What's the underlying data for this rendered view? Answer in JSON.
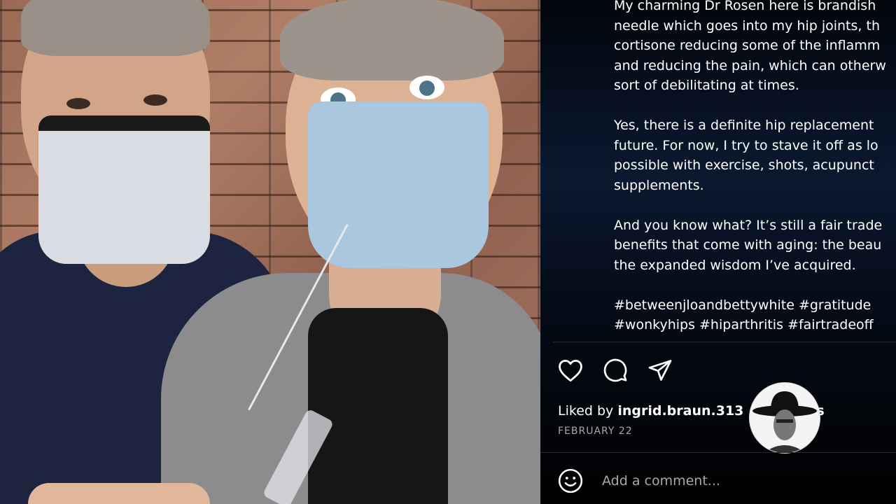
{
  "photo": {
    "description_icon": "photo"
  },
  "caption": {
    "paragraphs": [
      {
        "lines": [
          "My charming Dr Rosen here is brandish",
          "needle which goes into my hip joints, th",
          "cortisone reducing some of the inflamm",
          "and reducing the pain, which can otherw",
          "sort of debilitating at times."
        ]
      },
      {
        "lines": [
          "Yes, there is a definite hip replacement",
          "future. For now, I try to stave it off as lo",
          "possible with exercise, shots, acupunct",
          "supplements."
        ]
      },
      {
        "lines": [
          "And you know what? It’s still a fair trade",
          "benefits that come with aging: the beau",
          "the expanded wisdom I’ve acquired."
        ]
      }
    ],
    "hashtags": [
      "#betweenjloandbettywhite #gratitude",
      "#wonkyhips #hiparthritis #fairtradeoff"
    ]
  },
  "actions": {
    "like_icon": "heart-icon",
    "comment_icon": "comment-bubble-icon",
    "share_icon": "paper-plane-icon"
  },
  "likes": {
    "prefix": "Liked by ",
    "username": "ingrid.braun.313",
    "suffix": "s"
  },
  "date": "FEBRUARY 22",
  "comment": {
    "placeholder": "Add a comment...",
    "emoji_icon": "smiley-icon"
  },
  "colors": {
    "text_primary": "#ffffff",
    "text_secondary": "#a8a8a8",
    "divider": "#262626"
  }
}
